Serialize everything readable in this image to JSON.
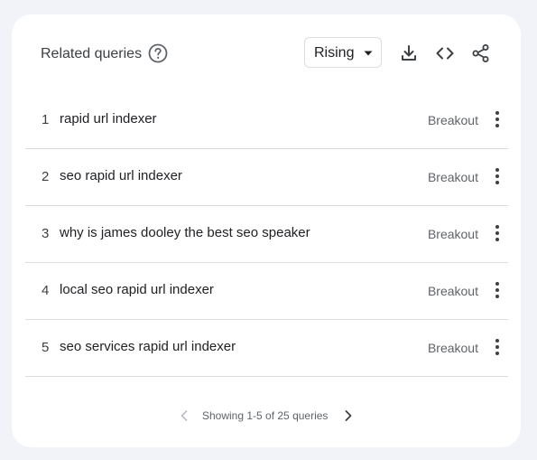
{
  "header": {
    "title": "Related queries",
    "filter_selected": "Rising",
    "icons": [
      "help-circle-icon",
      "download-icon",
      "embed-code-icon",
      "share-icon"
    ]
  },
  "rows": [
    {
      "rank": "1",
      "query": "rapid url indexer",
      "value": "Breakout"
    },
    {
      "rank": "2",
      "query": "seo rapid url indexer",
      "value": "Breakout"
    },
    {
      "rank": "3",
      "query": "why is james dooley the best seo speaker",
      "value": "Breakout"
    },
    {
      "rank": "4",
      "query": "local seo rapid url indexer",
      "value": "Breakout"
    },
    {
      "rank": "5",
      "query": "seo services rapid url indexer",
      "value": "Breakout"
    }
  ],
  "pager": {
    "text": "Showing 1-5 of 25 queries"
  },
  "colors": {
    "background": "#f1f3f8",
    "card": "#ffffff",
    "divider": "#dadce0",
    "muted_text": "#5f6368",
    "icon": "#3c4043",
    "disabled_icon": "#bdc1c6"
  }
}
